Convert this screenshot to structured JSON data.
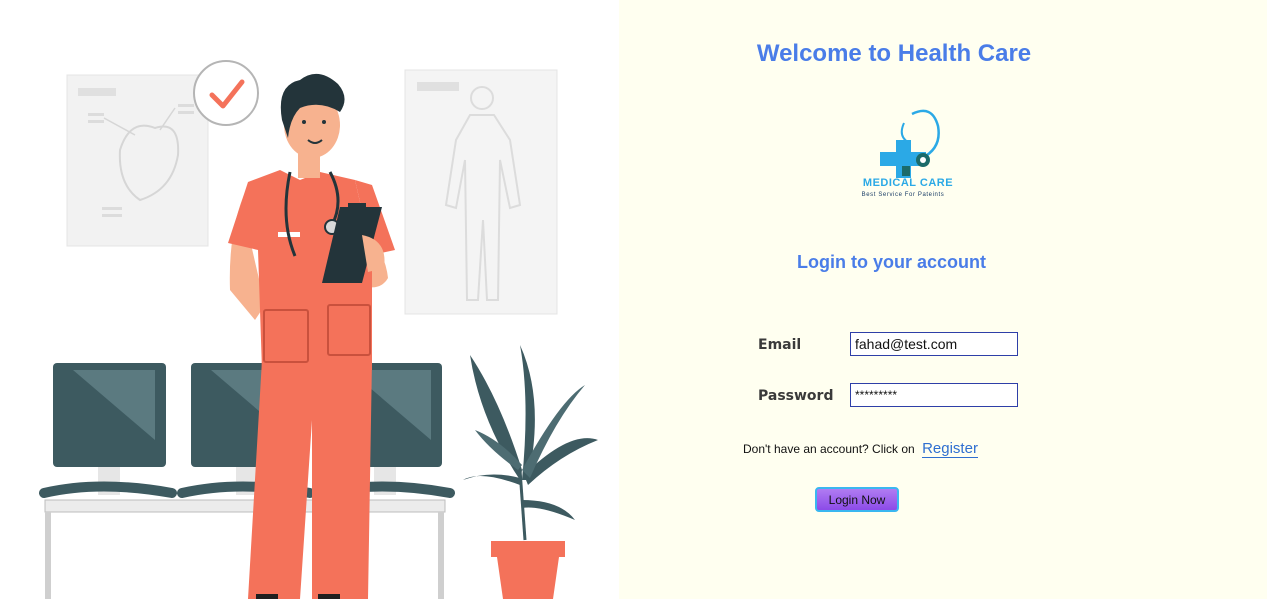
{
  "page": {
    "title": "Welcome to Health Care",
    "subtitle": "Login to your account"
  },
  "logo": {
    "name": "MEDICAL CARE",
    "tagline": "Best Service For Pateints"
  },
  "form": {
    "email_label": "Email",
    "email_value": "fahad@test.com",
    "password_label": "Password",
    "password_value": "*********",
    "register_prompt": "Don't have an account? Click on",
    "register_link": "Register",
    "submit_label": "Login Now"
  },
  "colors": {
    "accent": "#4a7de8",
    "panel_background": "#fffff0",
    "scrubs": "#f4725a",
    "monitor": "#3d5a60",
    "button": "#9b5cf0"
  }
}
